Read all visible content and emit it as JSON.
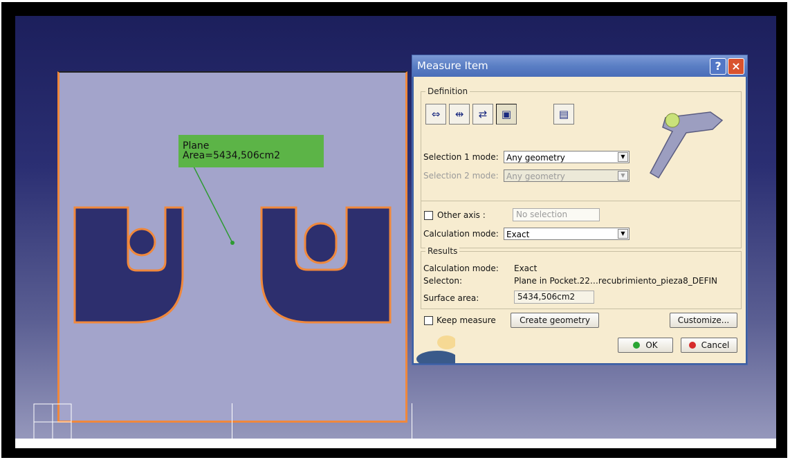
{
  "viewport": {
    "annotation": {
      "line1": "Plane",
      "line2": "Area=5434,506cm2"
    }
  },
  "dialog": {
    "title": "Measure Item",
    "help_label": "?",
    "close_label": "×",
    "definition": {
      "group_title": "Definition",
      "selection1_label": "Selection 1 mode:",
      "selection1_value": "Any geometry",
      "selection2_label": "Selection 2 mode:",
      "selection2_value": "Any geometry",
      "other_axis_label": "Other axis :",
      "other_axis_value": "No selection",
      "calc_mode_label": "Calculation mode:",
      "calc_mode_value": "Exact"
    },
    "results": {
      "group_title": "Results",
      "rows": [
        {
          "label": "Calculation mode:",
          "value": "Exact"
        },
        {
          "label": "Selecton:",
          "value": "Plane in Pocket.22…recubrimiento_pieza8_DEFIN"
        },
        {
          "label": "Surface area:",
          "value": "5434,506cm2"
        }
      ]
    },
    "keep_measure_label": "Keep measure",
    "create_geometry_label": "Create geometry",
    "customize_label": "Customize...",
    "ok_label": "OK",
    "cancel_label": "Cancel",
    "colors": {
      "ok_dot": "#2aa533",
      "cancel_dot": "#d62b2b"
    }
  }
}
